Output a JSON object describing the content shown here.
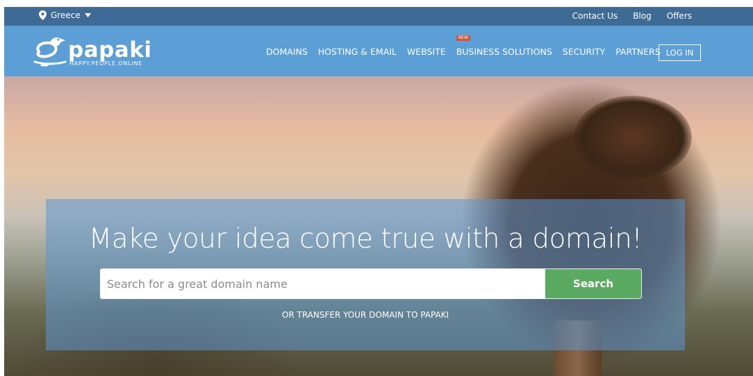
{
  "topbar": {
    "location": "Greece",
    "links": [
      "Contact Us",
      "Blog",
      "Offers"
    ]
  },
  "brand": {
    "name": "papaki",
    "tagline": "HAPPY.PEOPLE.ONLINE"
  },
  "nav": {
    "items": [
      "DOMAINS",
      "HOSTING & EMAIL",
      "WEBSITE",
      "BUSINESS SOLUTIONS",
      "SECURITY",
      "PARTNERS"
    ],
    "new_badge": "NEW",
    "login": "LOG IN"
  },
  "hero": {
    "headline": "Make your idea come true with a domain!",
    "search_placeholder": "Search for a great domain name",
    "search_button": "Search",
    "transfer_link": "OR TRANSFER YOUR DOMAIN TO PAPAKI"
  },
  "colors": {
    "topbar": "#3e6b96",
    "nav": "#5b9fd6",
    "search_button": "#5aab61",
    "new_badge": "#e0502c"
  }
}
